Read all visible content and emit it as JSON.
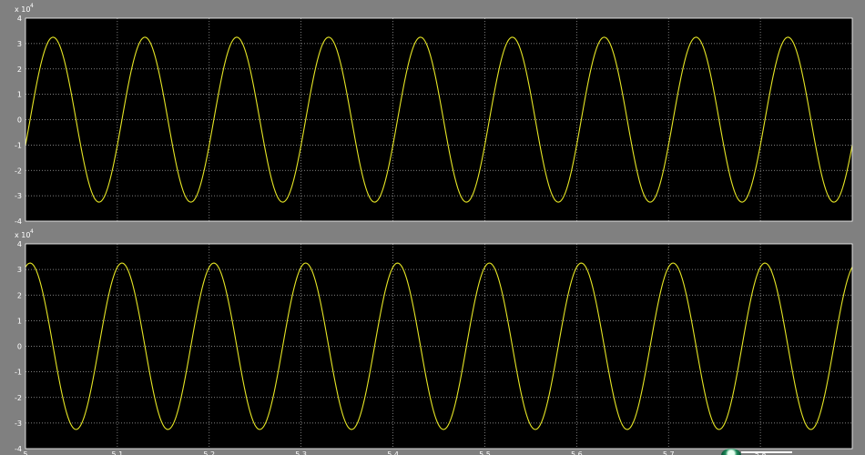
{
  "figure": {
    "background": "#808080",
    "axes_background": "#000000",
    "trace_color": "#e6e625",
    "grid_color": "#a8a8a8"
  },
  "chart_data": [
    {
      "type": "line",
      "title": "",
      "xlabel": "",
      "ylabel": "",
      "exponent_label": "x 10",
      "exponent_power": "4",
      "xlim": [
        5.0,
        5.9
      ],
      "ylim": [
        -4,
        4
      ],
      "y_ticks": [
        "-4",
        "-3",
        "-2",
        "-1",
        "0",
        "1",
        "2",
        "3",
        "4"
      ],
      "grid": true,
      "series": [
        {
          "amplitude": 3.25,
          "period": 0.1,
          "t_start": 5.0,
          "t_end": 5.9,
          "value_at_start": -1.1,
          "first_peak_t": 5.03,
          "first_trough_t": 5.08,
          "peak_value": 3.25,
          "trough_value": -3.25
        }
      ]
    },
    {
      "type": "line",
      "title": "",
      "xlabel": "",
      "ylabel": "",
      "exponent_label": "x 10",
      "exponent_power": "4",
      "xlim": [
        5.0,
        5.9
      ],
      "ylim": [
        -4,
        4
      ],
      "y_ticks": [
        "-4",
        "-3",
        "-2",
        "-1",
        "0",
        "1",
        "2",
        "3",
        "4"
      ],
      "x_ticks": [
        "5",
        "5.1",
        "5.2",
        "5.3",
        "5.4",
        "5.5",
        "5.6",
        "5.7",
        "5.8"
      ],
      "grid": true,
      "series": [
        {
          "amplitude": 3.25,
          "period": 0.1,
          "t_start": 5.0,
          "t_end": 5.9,
          "value_at_start": 3.1,
          "first_peak_t": 5.005,
          "first_trough_t": 5.055,
          "peak_value": 3.25,
          "trough_value": -3.25
        }
      ]
    }
  ]
}
